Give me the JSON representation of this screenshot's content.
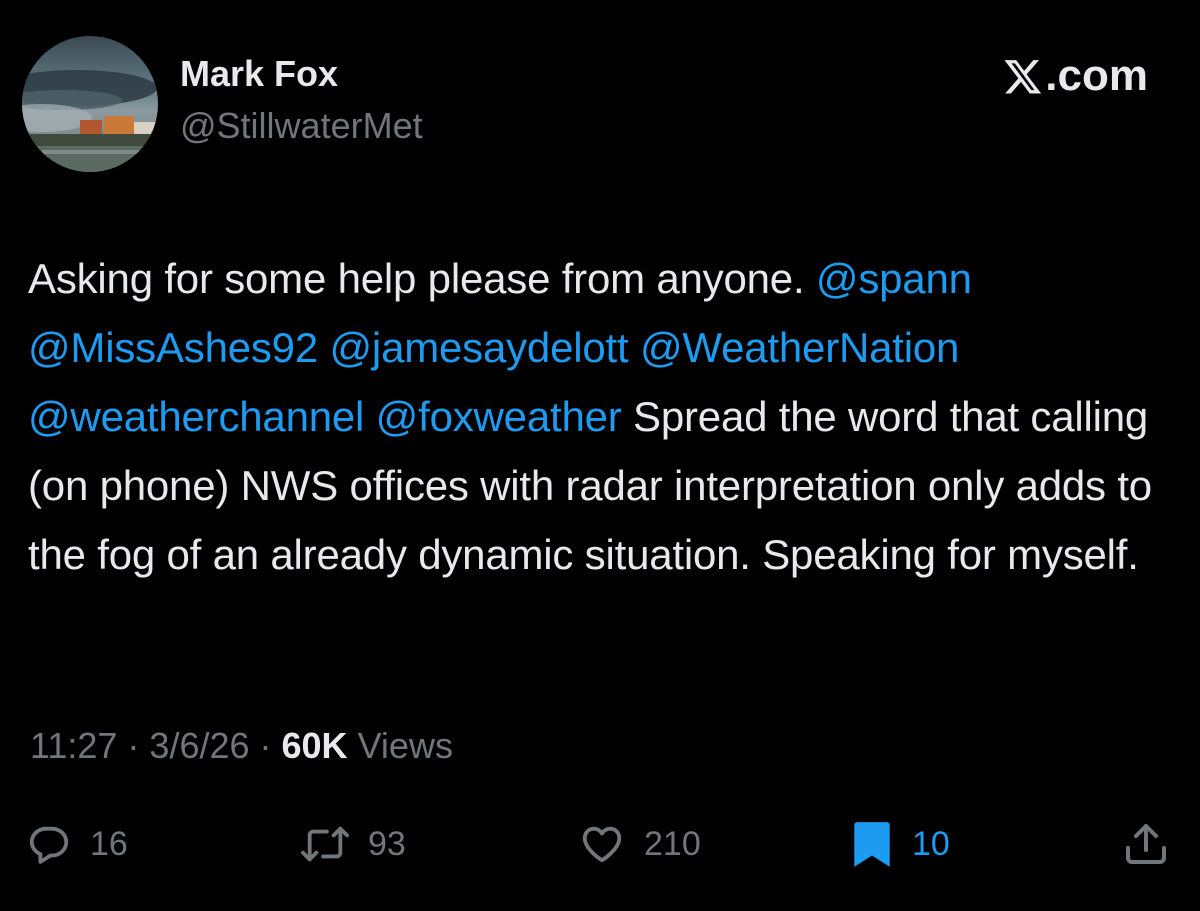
{
  "brand": {
    "text": ".com",
    "icon": "x-logo-icon"
  },
  "author": {
    "display_name": "Mark Fox",
    "handle": "@StillwaterMet",
    "avatar": "avatar-storm-cloud-photo"
  },
  "tweet": {
    "segments": [
      {
        "type": "text",
        "text": "Asking for some help please from anyone. "
      },
      {
        "type": "mention",
        "text": "@spann"
      },
      {
        "type": "text",
        "text": " "
      },
      {
        "type": "mention",
        "text": "@MissAshes92"
      },
      {
        "type": "text",
        "text": " "
      },
      {
        "type": "mention",
        "text": "@jamesaydelott"
      },
      {
        "type": "text",
        "text": " "
      },
      {
        "type": "mention",
        "text": "@WeatherNation"
      },
      {
        "type": "text",
        "text": " "
      },
      {
        "type": "mention",
        "text": "@weatherchannel"
      },
      {
        "type": "text",
        "text": " "
      },
      {
        "type": "mention",
        "text": "@foxweather"
      },
      {
        "type": "text",
        "text": "  Spread the word that calling (on phone) NWS offices with radar interpretation only adds to the fog of an already dynamic situation. Speaking for myself."
      }
    ]
  },
  "meta": {
    "time": "11:27",
    "separator": " · ",
    "date": "3/6/26",
    "views_count": "60K",
    "views_label": " Views"
  },
  "actions": {
    "reply": {
      "icon": "reply-icon",
      "count": "16"
    },
    "repost": {
      "icon": "repost-icon",
      "count": "93"
    },
    "like": {
      "icon": "heart-icon",
      "count": "210"
    },
    "bookmark": {
      "icon": "bookmark-icon",
      "count": "10",
      "active": true
    },
    "share": {
      "icon": "share-icon"
    }
  },
  "colors": {
    "background": "#000000",
    "text": "#e7e9ea",
    "secondary": "#71767b",
    "accent": "#1d9bf0"
  }
}
